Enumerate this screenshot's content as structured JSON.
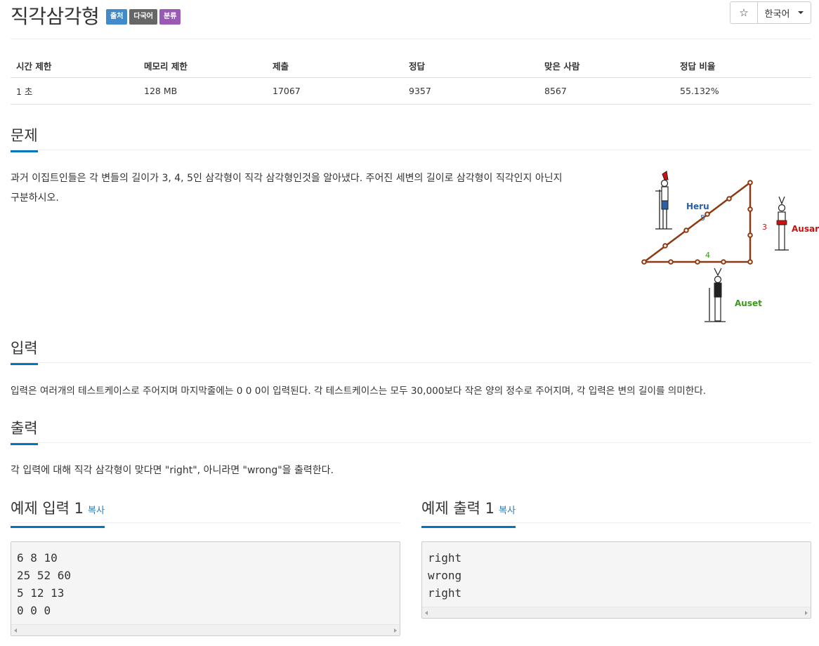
{
  "header": {
    "title": "직각삼각형",
    "labels": [
      {
        "text": "출처",
        "color": "#428bca"
      },
      {
        "text": "다국어",
        "color": "#666666"
      },
      {
        "text": "분류",
        "color": "#9b59b6"
      }
    ],
    "star": "☆",
    "language": "한국어"
  },
  "stats": {
    "headers": [
      "시간 제한",
      "메모리 제한",
      "제출",
      "정답",
      "맞은 사람",
      "정답 비율"
    ],
    "values": [
      "1 초",
      "128 MB",
      "17067",
      "9357",
      "8567",
      "55.132%"
    ]
  },
  "problem": {
    "heading": "문제",
    "text_line1": "과거 이집트인들은 각 변들의 길이가 3, 4, 5인 삼각형이 직각 삼각형인것을 알아냈다. 주어진 세변의 길이로 삼각형이 직각인지 아닌지",
    "text_line2": "구분하시오.",
    "figure": {
      "heru": "Heru",
      "ausar": "Ausar",
      "auset": "Auset",
      "side_a": "3",
      "side_b": "4",
      "side_c": "5"
    }
  },
  "input": {
    "heading": "입력",
    "text": "입력은 여러개의 테스트케이스로 주어지며 마지막줄에는 0 0 0이 입력된다. 각 테스트케이스는 모두 30,000보다 작은 양의 정수로 주어지며, 각 입력은 변의 길이를 의미한다."
  },
  "output": {
    "heading": "출력",
    "text": "각 입력에 대해 직각 삼각형이 맞다면 \"right\", 아니라면 \"wrong\"을 출력한다."
  },
  "sample_input": {
    "heading": "예제 입력 1",
    "copy": "복사",
    "lines": [
      "6 8 10",
      "25 52 60",
      "5 12 13",
      "0 0 0"
    ]
  },
  "sample_output": {
    "heading": "예제 출력 1",
    "copy": "복사",
    "lines": [
      "right",
      "wrong",
      "right"
    ]
  }
}
